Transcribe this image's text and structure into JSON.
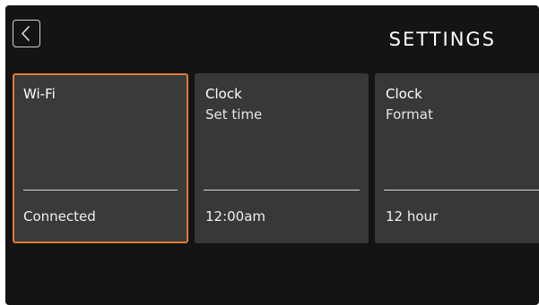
{
  "header": {
    "title": "SETTINGS",
    "back_icon": "chevron-left-icon"
  },
  "colors": {
    "background": "#141414",
    "tile": "#383838",
    "selection_accent": "#e07a35",
    "text": "#ffffff"
  },
  "tiles": [
    {
      "title": "Wi-Fi",
      "subtitle": "",
      "value": "Connected",
      "selected": true
    },
    {
      "title": "Clock",
      "subtitle": "Set time",
      "value": "12:00am",
      "selected": false
    },
    {
      "title": "Clock",
      "subtitle": "Format",
      "value": "12 hour",
      "selected": false
    }
  ]
}
